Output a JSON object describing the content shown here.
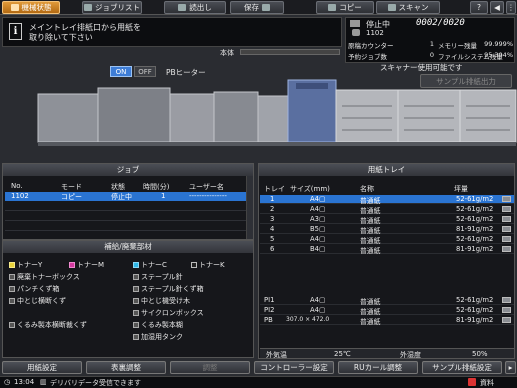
{
  "tabs": [
    {
      "label": "機械状態",
      "active": true
    },
    {
      "label": "ジョブリスト",
      "active": false
    },
    {
      "label": "読出し",
      "active": false
    },
    {
      "label": "保存",
      "active": false
    },
    {
      "label": "コピー",
      "active": false
    },
    {
      "label": "スキャン",
      "active": false
    }
  ],
  "message": {
    "line1": "メイントレイ排紙口から用紙を",
    "line2": "取り除いて下さい"
  },
  "status": {
    "state": "停止中",
    "counter": "0002/0020",
    "job_number": "1102",
    "rows": [
      {
        "k": "原稿カウンター",
        "v": "1",
        "k2": "メモリー残量",
        "v2": "99.999%"
      },
      {
        "k": "予約ジョブ数",
        "v": "0",
        "k2": "ファイルシステム残量",
        "v2": "95.304%"
      }
    ]
  },
  "body_label": "本体",
  "scanner_message": "スキャナー使用可能です",
  "sample_output_label": "サンプル排紙出力",
  "heater": {
    "on": "ON",
    "off": "OFF",
    "label": "PBヒーター"
  },
  "job_panel": {
    "title": "ジョブ",
    "headers": [
      "No.",
      "モード",
      "状態",
      "時間(分)",
      "ユーザー名"
    ],
    "rows": [
      [
        "1102",
        "コピー",
        "停止中",
        "1",
        "---------------"
      ]
    ]
  },
  "supplies_panel": {
    "title": "補給/廃棄部材",
    "items": [
      {
        "label": "トナーY",
        "color": "y"
      },
      {
        "label": "トナーM",
        "color": "m"
      },
      {
        "label": "トナーC",
        "color": "c"
      },
      {
        "label": "トナーK",
        "color": "k"
      },
      {
        "label": "廃棄トナーボックス",
        "color": ""
      },
      {
        "label": "ステープル針",
        "color": ""
      },
      {
        "label": "パンチくず箱",
        "color": ""
      },
      {
        "label": "ステープル針くず箱",
        "color": ""
      },
      {
        "label": "中とじ横断くず",
        "color": ""
      },
      {
        "label": "中とじ機受け木",
        "color": ""
      },
      {
        "label": "サイクロンボックス",
        "color": ""
      },
      {
        "label": "くるみ製本横断裁くず",
        "color": ""
      },
      {
        "label": "くるみ製本糊",
        "color": ""
      },
      {
        "label": "加湿用タンク",
        "color": ""
      }
    ]
  },
  "tray_panel": {
    "title": "用紙トレイ",
    "headers": [
      "トレイ",
      "サイズ(mm)",
      "名称",
      "坪量"
    ],
    "rows": [
      {
        "tray": "1",
        "size": "A4▢",
        "name": "普通紙",
        "weight": "52-61g/m2",
        "selected": true
      },
      {
        "tray": "2",
        "size": "A4▢",
        "name": "普通紙",
        "weight": "52-61g/m2",
        "selected": false
      },
      {
        "tray": "3",
        "size": "A3▢",
        "name": "普通紙",
        "weight": "52-61g/m2",
        "selected": false
      },
      {
        "tray": "4",
        "size": "B5▢",
        "name": "普通紙",
        "weight": "81-91g/m2",
        "selected": false
      },
      {
        "tray": "5",
        "size": "A4▢",
        "name": "普通紙",
        "weight": "52-61g/m2",
        "selected": false
      },
      {
        "tray": "6",
        "size": "B4▢",
        "name": "普通紙",
        "weight": "81-91g/m2",
        "selected": false
      }
    ],
    "rows_bottom": [
      {
        "tray": "PI1",
        "size": "A4▢",
        "name": "普通紙",
        "weight": "52-61g/m2"
      },
      {
        "tray": "PI2",
        "size": "A4▢",
        "name": "普通紙",
        "weight": "52-61g/m2"
      },
      {
        "tray": "PB",
        "size": "307.0 × 472.0",
        "name": "普通紙",
        "weight": "81-91g/m2"
      }
    ],
    "footer": {
      "temp_label": "外気温",
      "temp_value": "25℃",
      "hum_label": "外湿度",
      "hum_value": "50%"
    }
  },
  "bottom_buttons": [
    {
      "label": "用紙設定",
      "enabled": true
    },
    {
      "label": "表裏調整",
      "enabled": true
    },
    {
      "label": "調整",
      "enabled": false
    },
    {
      "label": "コントローラー設定",
      "enabled": true
    },
    {
      "label": "RUカール調整",
      "enabled": true
    },
    {
      "label": "サンプル排紙設定",
      "enabled": true
    }
  ],
  "statusline": {
    "time": "13:04",
    "text": "デリバリデータ受信できます",
    "right": "資料"
  }
}
